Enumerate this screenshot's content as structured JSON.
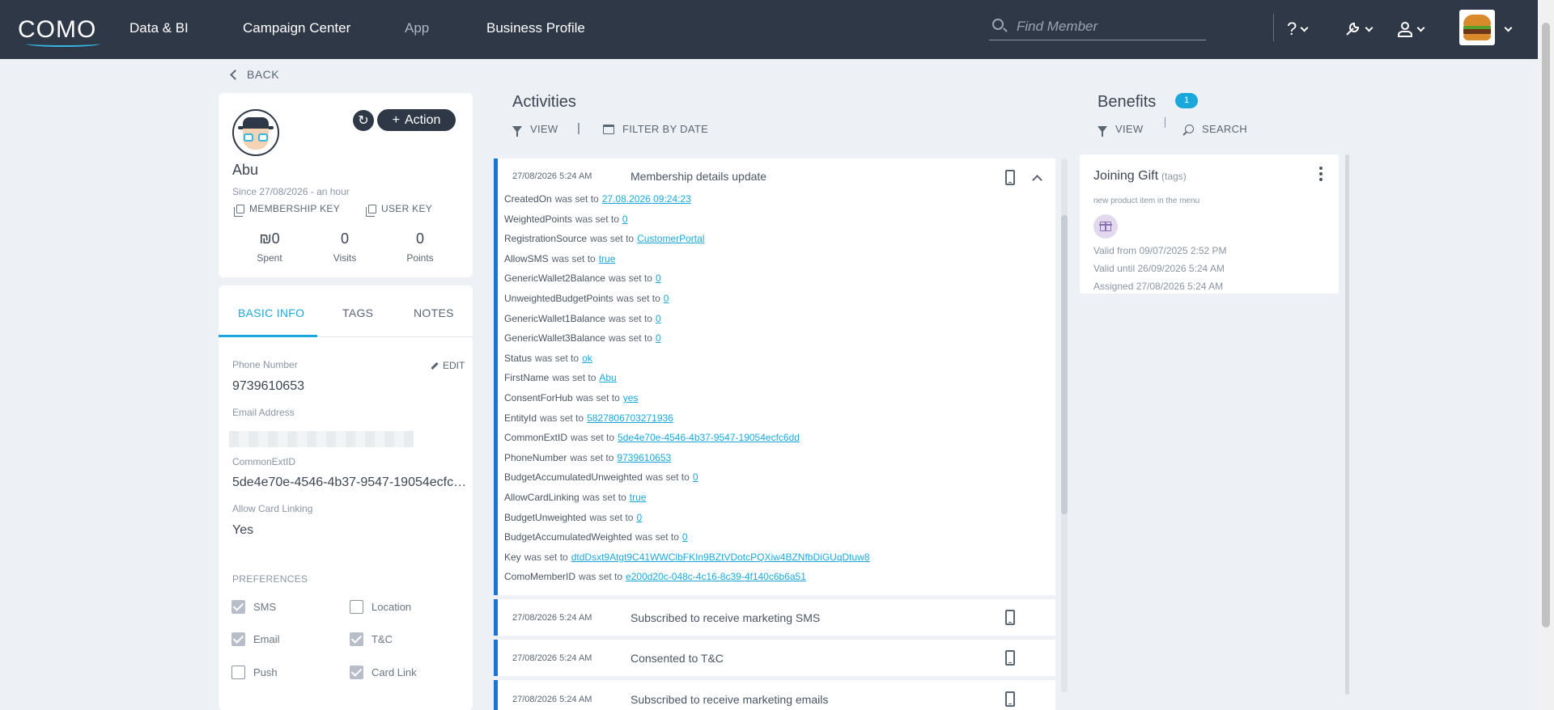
{
  "nav": {
    "logo": "COMO",
    "items": [
      "Data & BI",
      "Campaign Center",
      "App",
      "Business Profile"
    ],
    "search_placeholder": "Find Member",
    "help_icon": "?"
  },
  "back_label": "BACK",
  "member": {
    "name": "Abu",
    "since": "Since 27/08/2026 - an hour",
    "action_label": "Action",
    "membership_key_label": "MEMBERSHIP KEY",
    "user_key_label": "USER KEY",
    "stats": [
      {
        "value": "₪0",
        "label": "Spent"
      },
      {
        "value": "0",
        "label": "Visits"
      },
      {
        "value": "0",
        "label": "Points"
      }
    ]
  },
  "info": {
    "tabs": [
      "BASIC INFO",
      "TAGS",
      "NOTES"
    ],
    "edit_label": "EDIT",
    "fields": [
      {
        "label": "Phone Number",
        "value": "9739610653"
      },
      {
        "label": "Email Address",
        "value": ""
      },
      {
        "label": "CommonExtID",
        "value": "5de4e70e-4546-4b37-9547-19054ecfc6dd"
      },
      {
        "label": "Allow Card Linking",
        "value": "Yes"
      }
    ],
    "preferences_label": "PREFERENCES",
    "preferences": [
      {
        "label": "SMS",
        "checked": true
      },
      {
        "label": "Location",
        "checked": false
      },
      {
        "label": "Email",
        "checked": true
      },
      {
        "label": "T&C",
        "checked": true
      },
      {
        "label": "Push",
        "checked": false
      },
      {
        "label": "Card Link",
        "checked": true
      }
    ]
  },
  "activities": {
    "title": "Activities",
    "view_label": "VIEW",
    "separator": "|",
    "filter_label": "FILTER BY DATE",
    "set_word": "was set to",
    "items": [
      {
        "date": "27/08/2026 5:24 AM",
        "title": "Membership details update",
        "expanded": true,
        "changes": [
          {
            "key": "CreatedOn",
            "value": "27.08.2026 09:24:23"
          },
          {
            "key": "WeightedPoints",
            "value": "0"
          },
          {
            "key": "RegistrationSource",
            "value": "CustomerPortal"
          },
          {
            "key": "AllowSMS",
            "value": "true"
          },
          {
            "key": "GenericWallet2Balance",
            "value": "0"
          },
          {
            "key": "UnweightedBudgetPoints",
            "value": "0"
          },
          {
            "key": "GenericWallet1Balance",
            "value": "0"
          },
          {
            "key": "GenericWallet3Balance",
            "value": "0"
          },
          {
            "key": "Status",
            "value": "ok"
          },
          {
            "key": "FirstName",
            "value": "Abu"
          },
          {
            "key": "ConsentForHub",
            "value": "yes"
          },
          {
            "key": "EntityId",
            "value": "5827806703271936"
          },
          {
            "key": "CommonExtID",
            "value": "5de4e70e-4546-4b37-9547-19054ecfc6dd"
          },
          {
            "key": "PhoneNumber",
            "value": "9739610653"
          },
          {
            "key": "BudgetAccumulatedUnweighted",
            "value": "0"
          },
          {
            "key": "AllowCardLinking",
            "value": "true"
          },
          {
            "key": "BudgetUnweighted",
            "value": "0"
          },
          {
            "key": "BudgetAccumulatedWeighted",
            "value": "0"
          },
          {
            "key": "Key",
            "value": "dtdDsxt9Atgt9C41WWClbFKIn9BZtVDotcPQXiw4BZNfbDiGUqDtuw8"
          },
          {
            "key": "ComoMemberID",
            "value": "e200d20c-048c-4c16-8c39-4f140c6b6a51"
          }
        ]
      },
      {
        "date": "27/08/2026 5:24 AM",
        "title": "Subscribed to receive marketing SMS"
      },
      {
        "date": "27/08/2026 5:24 AM",
        "title": "Consented to T&C"
      },
      {
        "date": "27/08/2026 5:24 AM",
        "title": "Subscribed to receive marketing emails"
      }
    ]
  },
  "benefits": {
    "title": "Benefits",
    "count": "1",
    "view_label": "VIEW",
    "search_label": "SEARCH",
    "items": [
      {
        "name": "Joining Gift",
        "type": "(tags)",
        "description": "new product item in the menu",
        "valid_from": "Valid from 09/07/2025 2:52 PM",
        "valid_until": "Valid until 26/09/2026 5:24 AM",
        "assigned": "Assigned 27/08/2026 5:24 AM"
      }
    ]
  }
}
